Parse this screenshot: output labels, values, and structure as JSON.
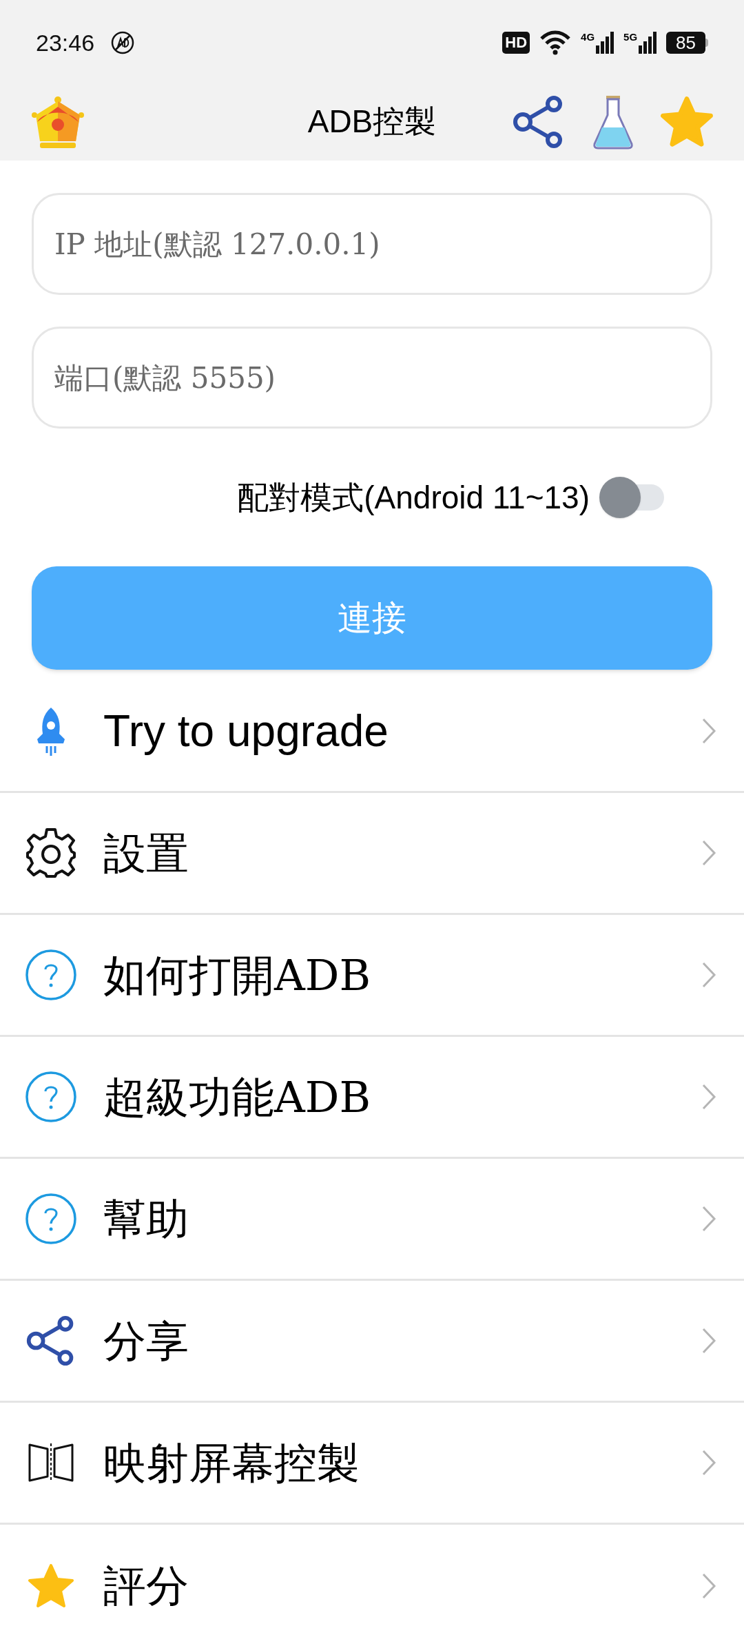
{
  "status_bar": {
    "time": "23:46",
    "battery": "85",
    "network_labels": [
      "4G",
      "5G"
    ],
    "hd_label": "HD"
  },
  "toolbar": {
    "title": "ADB控製"
  },
  "fields": [
    {
      "placeholder": "IP 地址(默認 127.0.0.1)"
    },
    {
      "placeholder": "端口(默認 5555)"
    }
  ],
  "pairing_toggle": {
    "label": "配對模式(Android 11~13)",
    "on": false
  },
  "connect_button": {
    "label": "連接"
  },
  "menu": [
    {
      "label": "Try to upgrade",
      "kind": "rocket"
    },
    {
      "label": "設置",
      "kind": "gear"
    },
    {
      "label": "如何打開ADB",
      "kind": "help"
    },
    {
      "label": "超級功能ADB",
      "kind": "help"
    },
    {
      "label": "幫助",
      "kind": "help"
    },
    {
      "label": "分享",
      "kind": "share"
    },
    {
      "label": "映射屏幕控製",
      "kind": "mirror"
    },
    {
      "label": "評分",
      "kind": "star"
    }
  ]
}
